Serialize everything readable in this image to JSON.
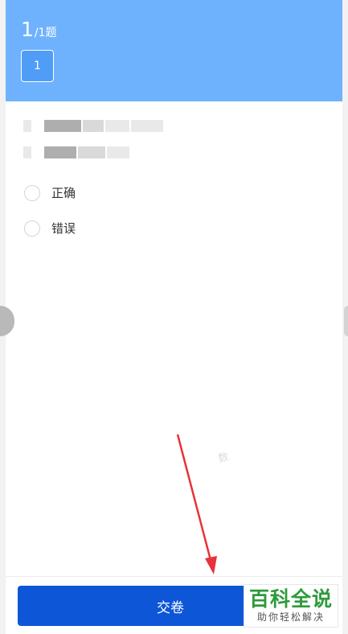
{
  "header": {
    "current": "1",
    "total": "/1题",
    "question_number": "1"
  },
  "options": [
    {
      "label": "正确"
    },
    {
      "label": "错误"
    }
  ],
  "submit_label": "交卷",
  "watermark": {
    "main": "百科全说",
    "sub": "助你轻松解决",
    "faint": "数"
  },
  "colors": {
    "header_bg": "#6eb2fd",
    "submit_bg": "#0d56d8",
    "annotation_arrow": "#e8323a",
    "watermark_green": "#2d9a3b"
  }
}
